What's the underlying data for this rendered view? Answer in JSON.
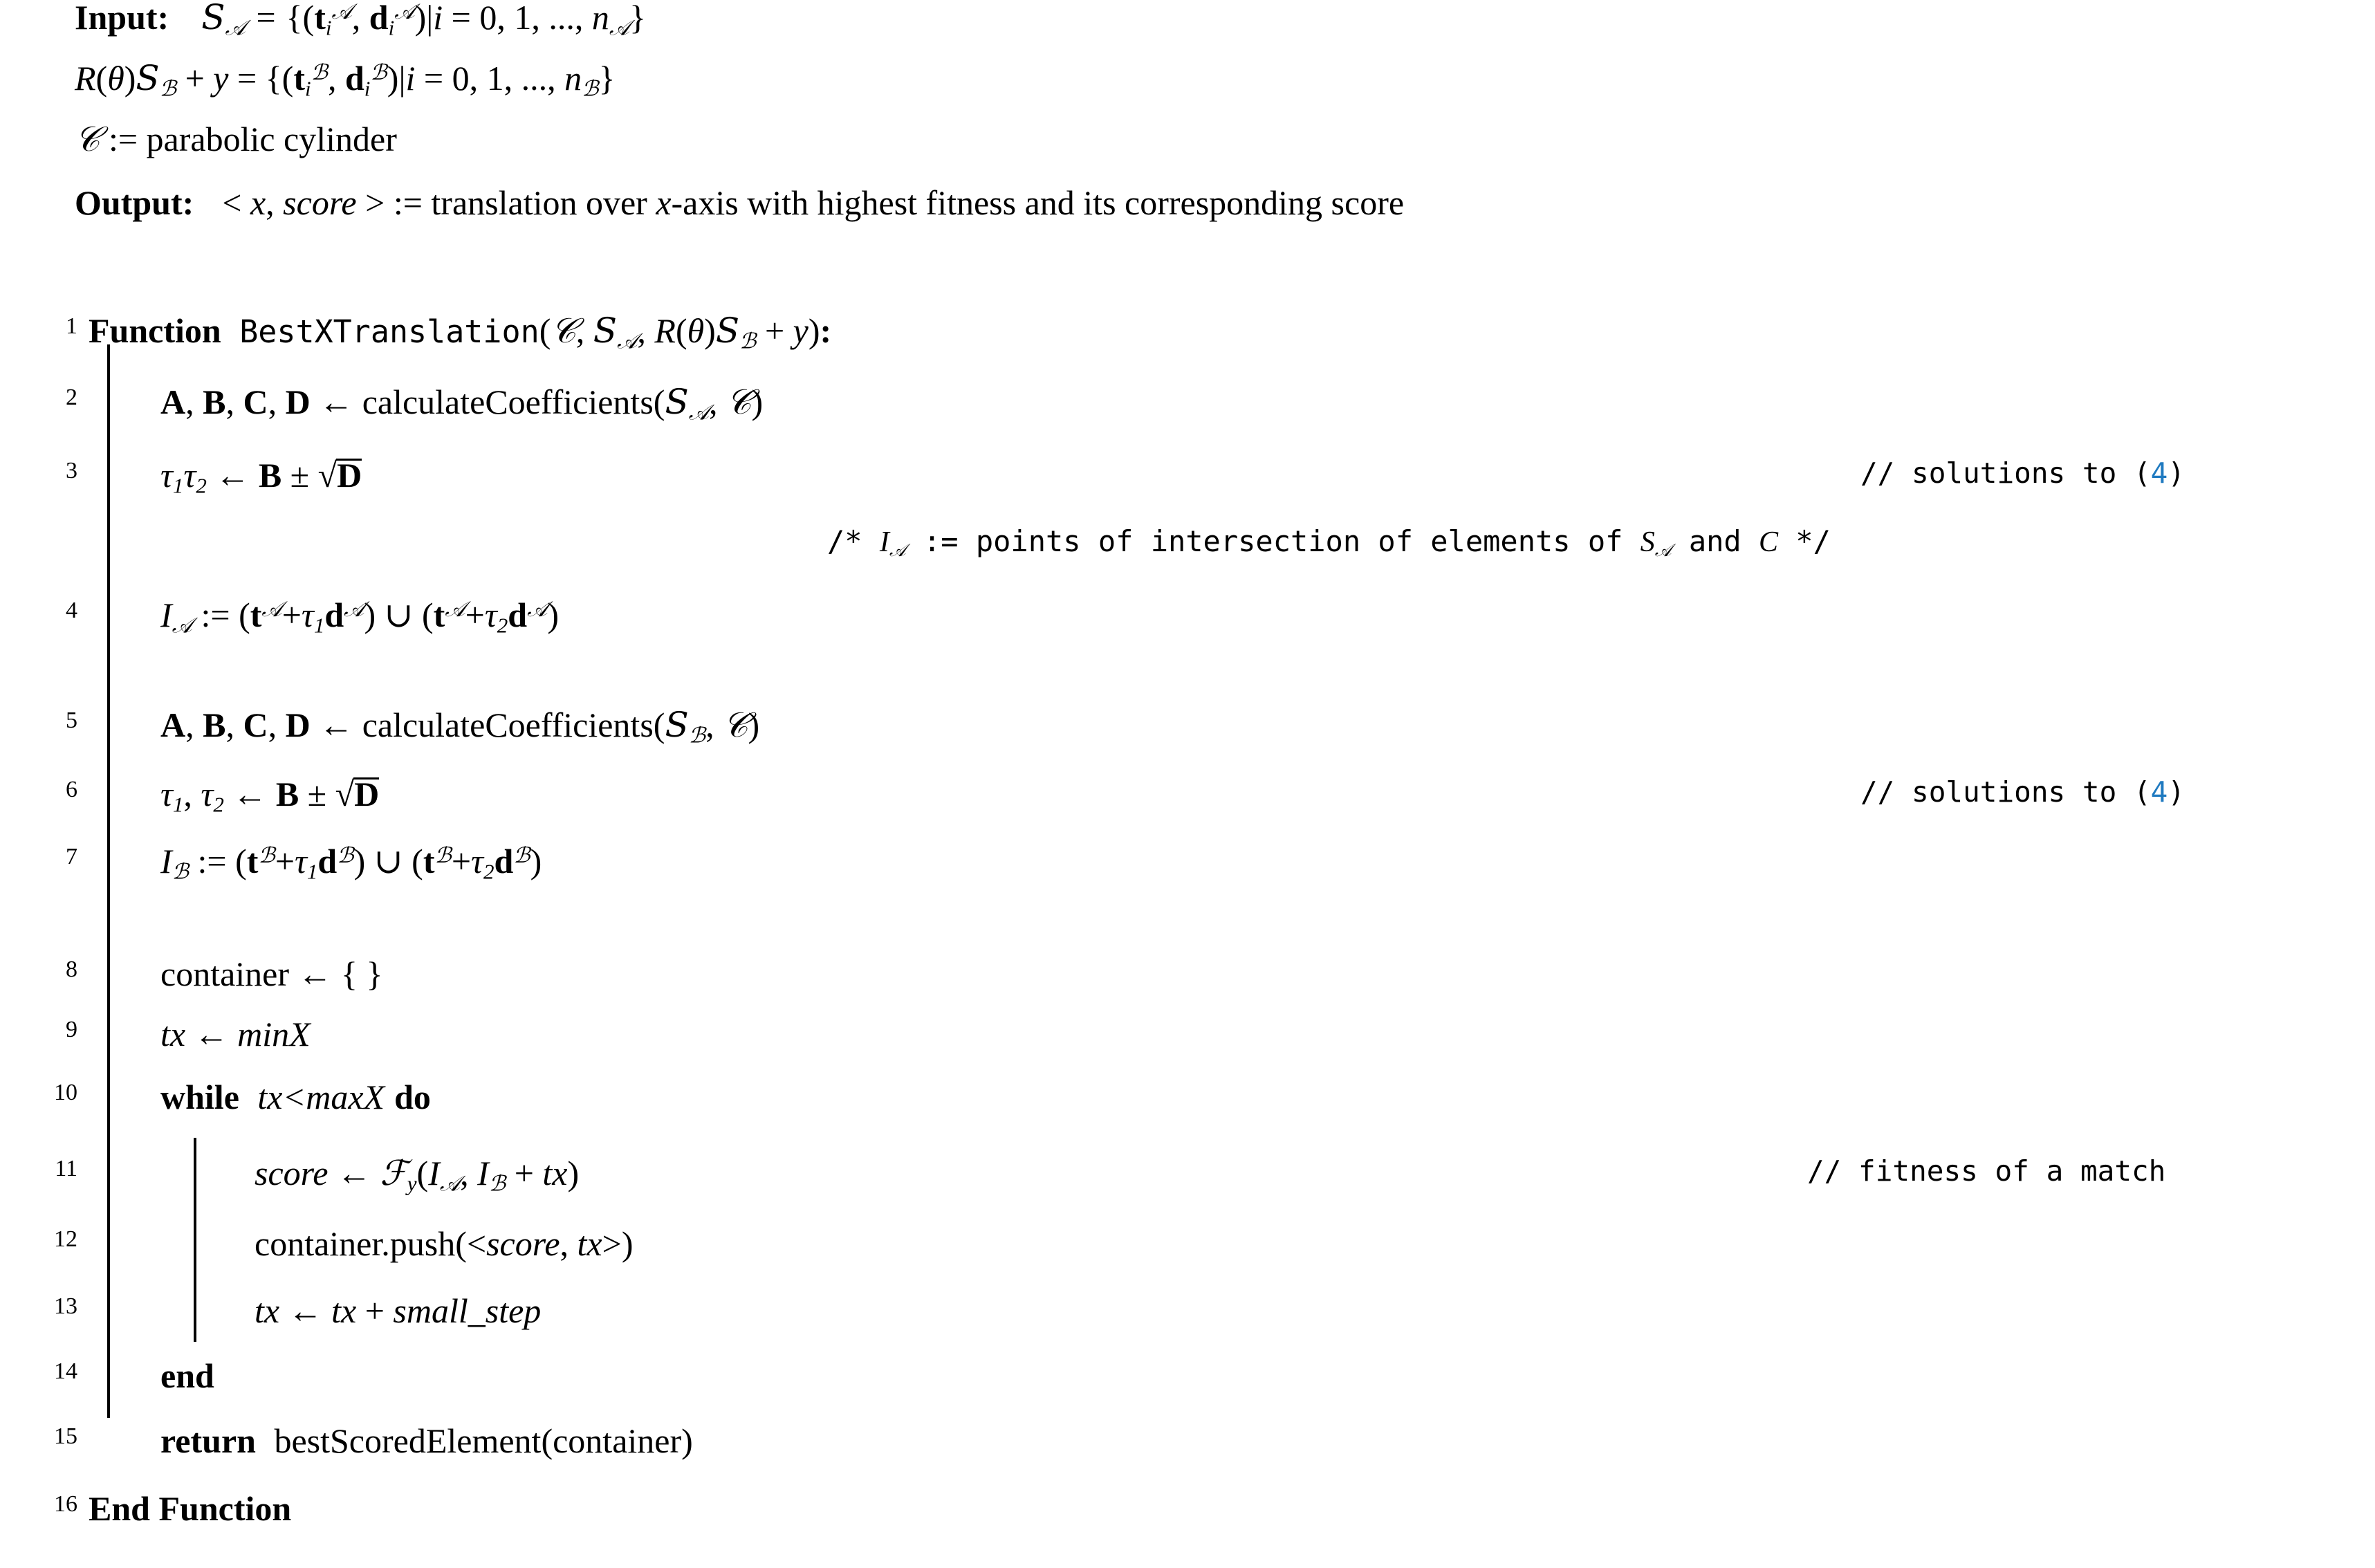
{
  "algorithm": {
    "header": {
      "input_label": "Input:",
      "input_line_1": "S_A = {(t_i^A, d_i^A)|i = 0, 1, ..., n_A}",
      "input_line_2": "R(θ)S_B + y = {(t_i^B, d_i^B)|i = 0, 1, ..., n_B}",
      "input_line_3": "C := parabolic cylinder",
      "output_label": "Output:",
      "output_line": "< x, score > := translation over x-axis with highest fitness and its corresponding score",
      "output_prefix": "< x, score >",
      "output_suffix": ":= translation over ",
      "output_xaxis": "x",
      "output_tail": "-axis with highest fitness and its corresponding score"
    },
    "lines": [
      {
        "number": "1",
        "keyword": "Function",
        "name": "BestXTranslation",
        "signature": "(C, S_A, R(θ)S_B + y):",
        "comment": ""
      },
      {
        "number": "2",
        "text": "A, B, C, D ← calculateCoefficients(S_A, C)",
        "comment": ""
      },
      {
        "number": "3",
        "text": "τ1τ2 ← B ± √D",
        "comment": "// solutions to (4)",
        "comment_ref": "4"
      },
      {
        "number": "",
        "text": "/* I_A := points of intersection of elements of S_A and C */",
        "is_block_comment": true
      },
      {
        "number": "4",
        "text": "I_A := (t^A+τ1 d^A) ∪ (t^A+τ2 d^A)",
        "comment": ""
      },
      {
        "number": "5",
        "text": "A, B, C, D ← calculateCoefficients(S_B, C)",
        "comment": ""
      },
      {
        "number": "6",
        "text": "τ1, τ2 ← B ± √D",
        "comment": "// solutions to (4)",
        "comment_ref": "4"
      },
      {
        "number": "7",
        "text": "I_B := (t^B+τ1 d^B) ∪ (t^B+τ2 d^B)",
        "comment": ""
      },
      {
        "number": "8",
        "text": "container ← { }",
        "comment": ""
      },
      {
        "number": "9",
        "text": "tx ← minX",
        "comment": ""
      },
      {
        "number": "10",
        "text": "while tx<maxX do",
        "comment": ""
      },
      {
        "number": "11",
        "text": "score ← F_y(I_A, I_B + tx)",
        "comment": "// fitness of a match"
      },
      {
        "number": "12",
        "text": "container.push(<score, tx>)",
        "comment": ""
      },
      {
        "number": "13",
        "text": "tx ← tx + small_step",
        "comment": ""
      },
      {
        "number": "14",
        "text": "end",
        "comment": ""
      },
      {
        "number": "15",
        "text": "return bestScoredElement(container)",
        "comment": ""
      },
      {
        "number": "16",
        "text": "End Function",
        "comment": ""
      }
    ],
    "comments": {
      "solutions_to_4_prefix": "// solutions to (",
      "solutions_to_4_ref": "4",
      "solutions_to_4_suffix": ")",
      "block_comment_open": "/* ",
      "block_comment_mid": " := points of intersection of elements of ",
      "block_comment_and": " and ",
      "block_comment_close": " */",
      "fitness_of_a_match": "// fitness of a match"
    },
    "keywords": {
      "function": "Function",
      "while": "while",
      "do": "do",
      "end": "end",
      "return": "return",
      "end_function": "End Function"
    },
    "identifiers": {
      "best_x_translation": "BestXTranslation",
      "calculate_coefficients": "calculateCoefficients",
      "container": "container",
      "container_push": "container.push",
      "best_scored_element": "bestScoredElement",
      "min_x": "minX",
      "max_x": "maxX",
      "small_step": "small_step",
      "score": "score",
      "tx": "tx",
      "parabolic_cylinder": "parabolic cylinder"
    },
    "colors": {
      "text": "#000000",
      "reference_link": "#1f7ac0",
      "background": "#ffffff"
    }
  }
}
